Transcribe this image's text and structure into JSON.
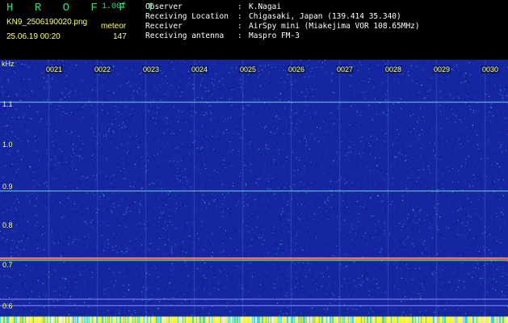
{
  "header": {
    "app_title": "H R O F F T",
    "version": "1.00f",
    "file_name": "KN9_2506190020.png",
    "meteor_label": "meteor",
    "timestamp": "25.06.19 00:20",
    "meteor_count": "147"
  },
  "info": [
    {
      "key": "Observer",
      "sep": ":",
      "value": "K.Nagai"
    },
    {
      "key": "Receiving Location",
      "sep": ":",
      "value": "Chigasaki, Japan (139.414 35.340)"
    },
    {
      "key": "Receiver",
      "sep": ":",
      "value": "AirSpy mini (Miakejima VOR 108.65MHz)"
    },
    {
      "key": "Receiving antenna",
      "sep": ":",
      "value": "Maspro FM-3"
    }
  ],
  "spectrogram": {
    "y_unit": "kHz",
    "y_ticks": [
      "1.1",
      "1.0",
      "0.9",
      "0.8",
      "0.7",
      "0.6"
    ],
    "x_ticks": [
      "0021",
      "0022",
      "0023",
      "0024",
      "0025",
      "0026",
      "0027",
      "0028",
      "0029",
      "0030"
    ],
    "colors": {
      "background": "#1a2aa0",
      "label": "#ffff66",
      "signal": "#ff3a3a",
      "title": "#2fe07a"
    }
  }
}
